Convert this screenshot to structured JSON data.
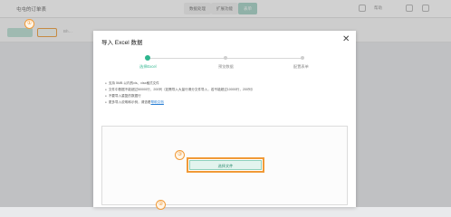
{
  "app": {
    "title": "屯屯的订单表",
    "segments": [
      "数据处理",
      "扩展功能",
      "表单"
    ],
    "help_label": "帮助"
  },
  "toolbar": {
    "more_label": "Bh…"
  },
  "dialog": {
    "title": "导入 Excel 数据",
    "close_glyph": "✕",
    "steps": [
      {
        "label": "选择Excel",
        "active": true
      },
      {
        "label": "预览数据",
        "active": false
      },
      {
        "label": "配置表单",
        "active": false
      }
    ],
    "rules": [
      "支持 5MB 以内的xls、xlsx格式文件",
      "文件中数据不能超过50000行，200列（如需导入大量行请分文件导入，若不能超过10000行，200列）",
      "不要导入重复的数据行",
      "更多导入说明和示例，请查看"
    ],
    "rules_link": "帮助文档",
    "pick_button": "选择文件"
  },
  "markers": [
    "①",
    "②",
    "③"
  ]
}
